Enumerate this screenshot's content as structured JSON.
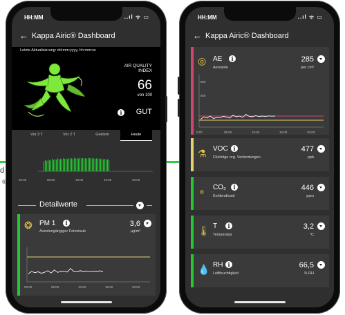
{
  "edge": {
    "line1": "d",
    "line2": "®"
  },
  "colors": {
    "green": "#23c832",
    "yellow": "#e6d26a",
    "pink": "#d2466e",
    "chart_line": "#ffffff"
  },
  "left_phone": {
    "status": {
      "time": "HH:MM",
      "system_icons": "..ıl ᯤ ▭"
    },
    "appbar": {
      "back_icon": "←",
      "title": "Kappa Airic® Dashboard"
    },
    "hero": {
      "last_update": "Letzte Aktualisierung: dd:mm:yyyy, hh:mm:ss",
      "aq_label": "AIR QUALITY INDEX",
      "aq_value": "66",
      "aq_scale": "von 100",
      "info": "i",
      "aq_status": "GUT"
    },
    "tabs": [
      "Vor 3 T",
      "Vor 2 T",
      "Gestern",
      "Heute"
    ],
    "active_tab": "Heute",
    "overview_chart": {
      "type": "bar",
      "x_ticks": [
        "00:00",
        "05:00",
        "10:00",
        "15:00",
        "20:00"
      ],
      "values": [
        0.55,
        0.62,
        0.58,
        0.66,
        0.6,
        0.64,
        0.7,
        0.63,
        0.68,
        0.65,
        0.72,
        0.66,
        0.7,
        0.67,
        0.73,
        0.69,
        0.71,
        0.68,
        0.74,
        0.7,
        0.72,
        0.69,
        0.75,
        0.71,
        0.73,
        0.7,
        0.76,
        0.72,
        0.74,
        0.71,
        0.73,
        0.7,
        0.75,
        0.72,
        0.74,
        0.71,
        0.73,
        0.69,
        0.72,
        0.7,
        0.71,
        0.68,
        0.7,
        0.66,
        0.69,
        0.65,
        0.67,
        0.64
      ]
    },
    "section": {
      "label": "Detailwerte"
    },
    "pm_card": {
      "name": "PM 1",
      "subtitle": "Aveolengängiger Feinstaub",
      "value": "3,6",
      "unit": "µg/m³",
      "x_ticks": [
        "00:00",
        "05:00",
        "10:00",
        "15:00",
        "20:00"
      ],
      "line": [
        0.35,
        0.5,
        0.42,
        0.48,
        0.38,
        0.45,
        0.55,
        0.4,
        0.6,
        0.44,
        0.5,
        0.52,
        0.46,
        0.7,
        0.5,
        0.48,
        0.55,
        0.5,
        0.53,
        0.49,
        0.52,
        0.5,
        0.54,
        0.5
      ]
    }
  },
  "right_phone": {
    "status": {
      "time": "HH:MM",
      "system_icons": "..ıl ᯤ ▭"
    },
    "appbar": {
      "back_icon": "←",
      "title": "Kappa Airic® Dashboard"
    },
    "ae_card": {
      "name": "AE",
      "subtitle": "Aerosole",
      "value": "285",
      "unit": "per cm³",
      "y_ticks": [
        "600",
        "400"
      ],
      "x_ticks": [
        "0:00",
        "05:00",
        "10:00",
        "15:00",
        "20:00"
      ],
      "line": [
        0.3,
        0.45,
        0.38,
        0.5,
        0.35,
        0.42,
        0.4,
        0.48,
        0.44,
        0.38,
        0.55,
        0.45,
        0.5,
        0.42,
        0.6,
        0.48,
        0.46,
        0.52,
        0.47,
        0.5,
        0.48,
        0.51,
        0.49,
        0.5
      ]
    },
    "metrics": [
      {
        "name": "VOC",
        "sub_html": "",
        "subtitle": "Flüchtige org. Verbindungen",
        "value": "477",
        "unit": "ppb",
        "color": "#e6d26a",
        "icon": "voc-icon",
        "glyph": "⚗"
      },
      {
        "name": "CO₂",
        "subtitle": "Kohlendioxid",
        "value": "446",
        "unit": "ppm",
        "color": "#23c832",
        "icon": "co2-molecule-icon",
        "glyph": "⚬"
      },
      {
        "name": "T",
        "subtitle": "Temperatur",
        "value": "3,2",
        "unit": "°C",
        "color": "#23c832",
        "icon": "thermometer-icon",
        "glyph": "🌡"
      },
      {
        "name": "RH",
        "subtitle": "Luftfeuchtigkeit",
        "value": "66,5",
        "unit": "% RH",
        "color": "#23c832",
        "icon": "water-drop-icon",
        "glyph": "💧"
      }
    ]
  }
}
